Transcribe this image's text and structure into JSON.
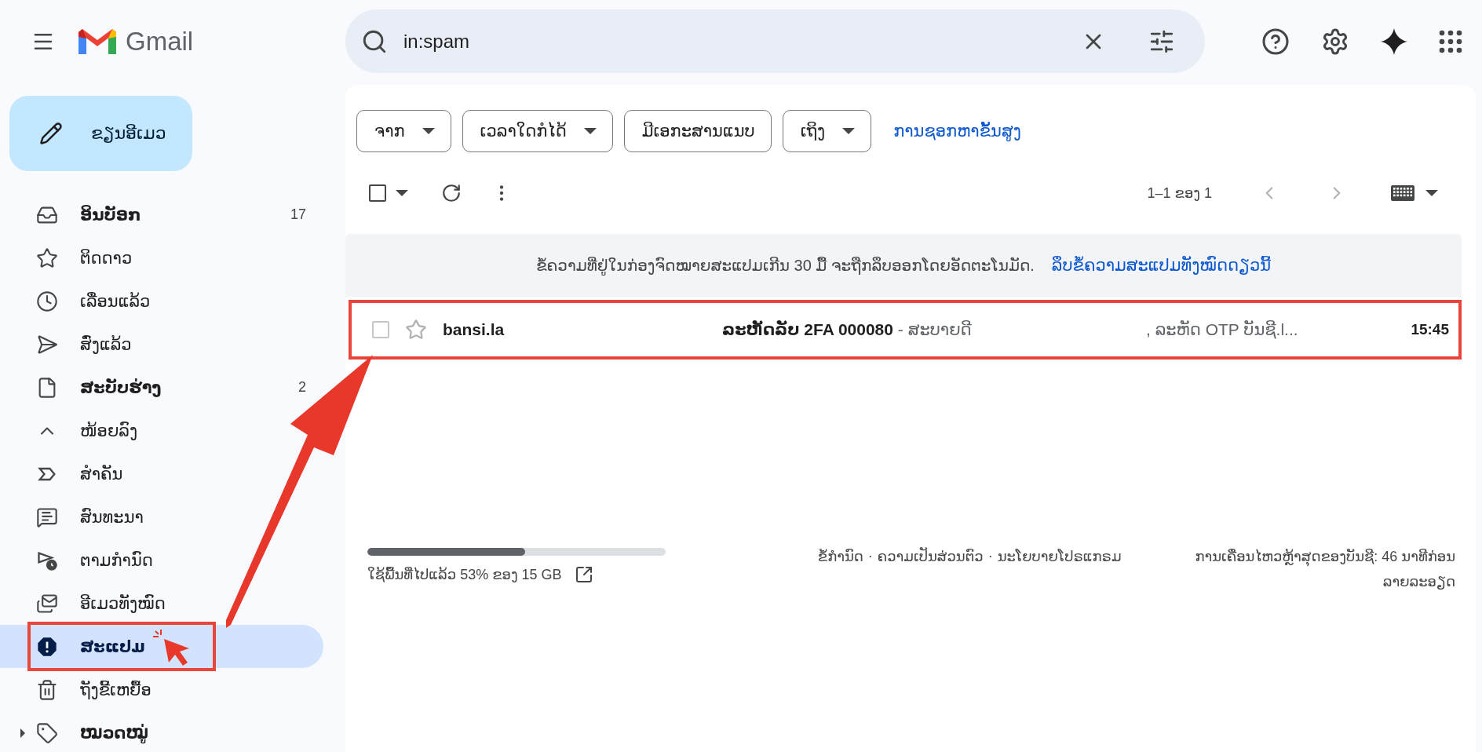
{
  "header": {
    "brand": "Gmail",
    "search": {
      "value": "in:spam"
    }
  },
  "compose": {
    "label": "ຂຽນອີເມວ"
  },
  "nav": [
    {
      "label": "ອິນບັອກ",
      "count": "17",
      "bold": true,
      "selected": false,
      "annotated": false
    },
    {
      "label": "ຕິດດາວ",
      "bold": false,
      "selected": false,
      "annotated": false
    },
    {
      "label": "ເລື່ອນແລ້ວ",
      "bold": false,
      "selected": false,
      "annotated": false
    },
    {
      "label": "ສົ່ງແລ້ວ",
      "bold": false,
      "selected": false,
      "annotated": false
    },
    {
      "label": "ສະບັບຮ່າງ",
      "count": "2",
      "bold": true,
      "selected": false,
      "annotated": false
    },
    {
      "label": "ໜ້ອຍລົງ",
      "bold": false,
      "selected": false,
      "annotated": false
    },
    {
      "label": "ສຳຄັນ",
      "bold": false,
      "selected": false,
      "annotated": false
    },
    {
      "label": "ສົນທະນາ",
      "bold": false,
      "selected": false,
      "annotated": false
    },
    {
      "label": "ຕາມກຳນົດ",
      "bold": false,
      "selected": false,
      "annotated": false
    },
    {
      "label": "ອີເມວທັງໝົດ",
      "bold": false,
      "selected": false,
      "annotated": false
    },
    {
      "label": "ສະແປມ",
      "bold": true,
      "selected": true,
      "annotated": true
    },
    {
      "label": "ຖັງຂີ້ເຫຍື້ອ",
      "bold": false,
      "selected": false,
      "annotated": false
    },
    {
      "label": "ໝວດໝູ່",
      "bold": true,
      "selected": false,
      "annotated": false
    }
  ],
  "filters": [
    {
      "label": "ຈາກ",
      "dropdown": true
    },
    {
      "label": "ເວລາໃດກໍໄດ້",
      "dropdown": true
    },
    {
      "label": "ມີເອກະສານແນບ",
      "dropdown": false
    },
    {
      "label": "ເຖິງ",
      "dropdown": true
    }
  ],
  "advanced_search": "ການຊອກຫາຂັ້ນສູງ",
  "toolbar": {
    "range": "1–1 ຂອງ 1",
    "select_all_checked": false
  },
  "banner": {
    "text": "ຂໍ້ຄວາມທີ່ຢູ່ໃນກ່ອງຈົດໝາຍສະແປມເກີນ 30 ມື້ ຈະຖືກລຶບອອກໂດຍອັດຕະໂນມັດ.",
    "link": "ລຶບຂໍ້ຄວາມສະແປມທັງໝົດດຽວນີ້"
  },
  "emails": [
    {
      "sender": "bansi.la",
      "subject": "ລະຫັດລັບ 2FA 000080",
      "snippet": "- ສະບາຍດີ",
      "preview": ", ລະຫັດ OTP ບັນຊີ.l...",
      "time": "15:45",
      "unread": true,
      "checked": false,
      "starred": false,
      "annotated": true
    }
  ],
  "footer": {
    "storage": {
      "level": 0.53,
      "text": "ໃຊ້ພື້ນທີ່ໄປແລ້ວ 53% ຂອງ 15 GB"
    },
    "links": [
      "ຂໍ້ກຳນົດ",
      "ຄວາມເປັນສ່ວນຕົວ",
      "ນະໂຍບາຍໂປຣແກຣມ"
    ],
    "separator": "·",
    "activity": "ການເຄື່ອນໄຫວຫຼ້າສຸດຂອງບັນຊີ: 46 ນາທີກ່ອນ",
    "details": "ລາຍລະອຽດ"
  }
}
